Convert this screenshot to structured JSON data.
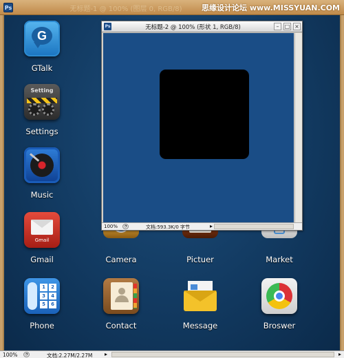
{
  "window": {
    "app_icon": "Ps",
    "title": "无标题-1 @ 100% (图层 0, RGB/8)",
    "watermark": "思缘设计论坛 www.MISSYUAN.COM"
  },
  "apps": [
    {
      "label": "GTalk",
      "icon": "gtalk-icon"
    },
    {
      "label": "Settings",
      "icon": "settings-icon",
      "icon_text": "Setting"
    },
    {
      "label": "Music",
      "icon": "music-icon"
    },
    {
      "label": "Gmail",
      "icon": "gmail-icon",
      "icon_text": "Gmail"
    },
    {
      "label": "Camera",
      "icon": "camera-icon"
    },
    {
      "label": "Pictuer",
      "icon": "pictures-icon"
    },
    {
      "label": "Market",
      "icon": "market-icon"
    },
    {
      "label": "Phone",
      "icon": "phone-icon",
      "keys": [
        "1",
        "2",
        "3",
        "4",
        "5",
        "6"
      ]
    },
    {
      "label": "Contact",
      "icon": "contact-icon"
    },
    {
      "label": "Message",
      "icon": "message-icon"
    },
    {
      "label": "Broswer",
      "icon": "browser-icon"
    }
  ],
  "document_window": {
    "app_icon": "Ps",
    "title": "无标题-2 @ 100% (形状 1, RGB/8)",
    "minimize": "–",
    "maximize": "□",
    "close": "×",
    "status": {
      "zoom": "100%",
      "doc_info": "文档:593.3K/0 字节",
      "arrow": "▸",
      "scroll_arrow": "◂"
    }
  },
  "status_bar": {
    "zoom": "100%",
    "doc_info": "文档:2.27M/2.27M",
    "arrow": "▸",
    "scroll_arrow": "◂",
    "end_arrow": "▸"
  },
  "colors": {
    "desktop_bg": "#123a61",
    "canvas_bg": "#1a4d86",
    "shape": "#000000",
    "frame": "#c8a06a"
  }
}
